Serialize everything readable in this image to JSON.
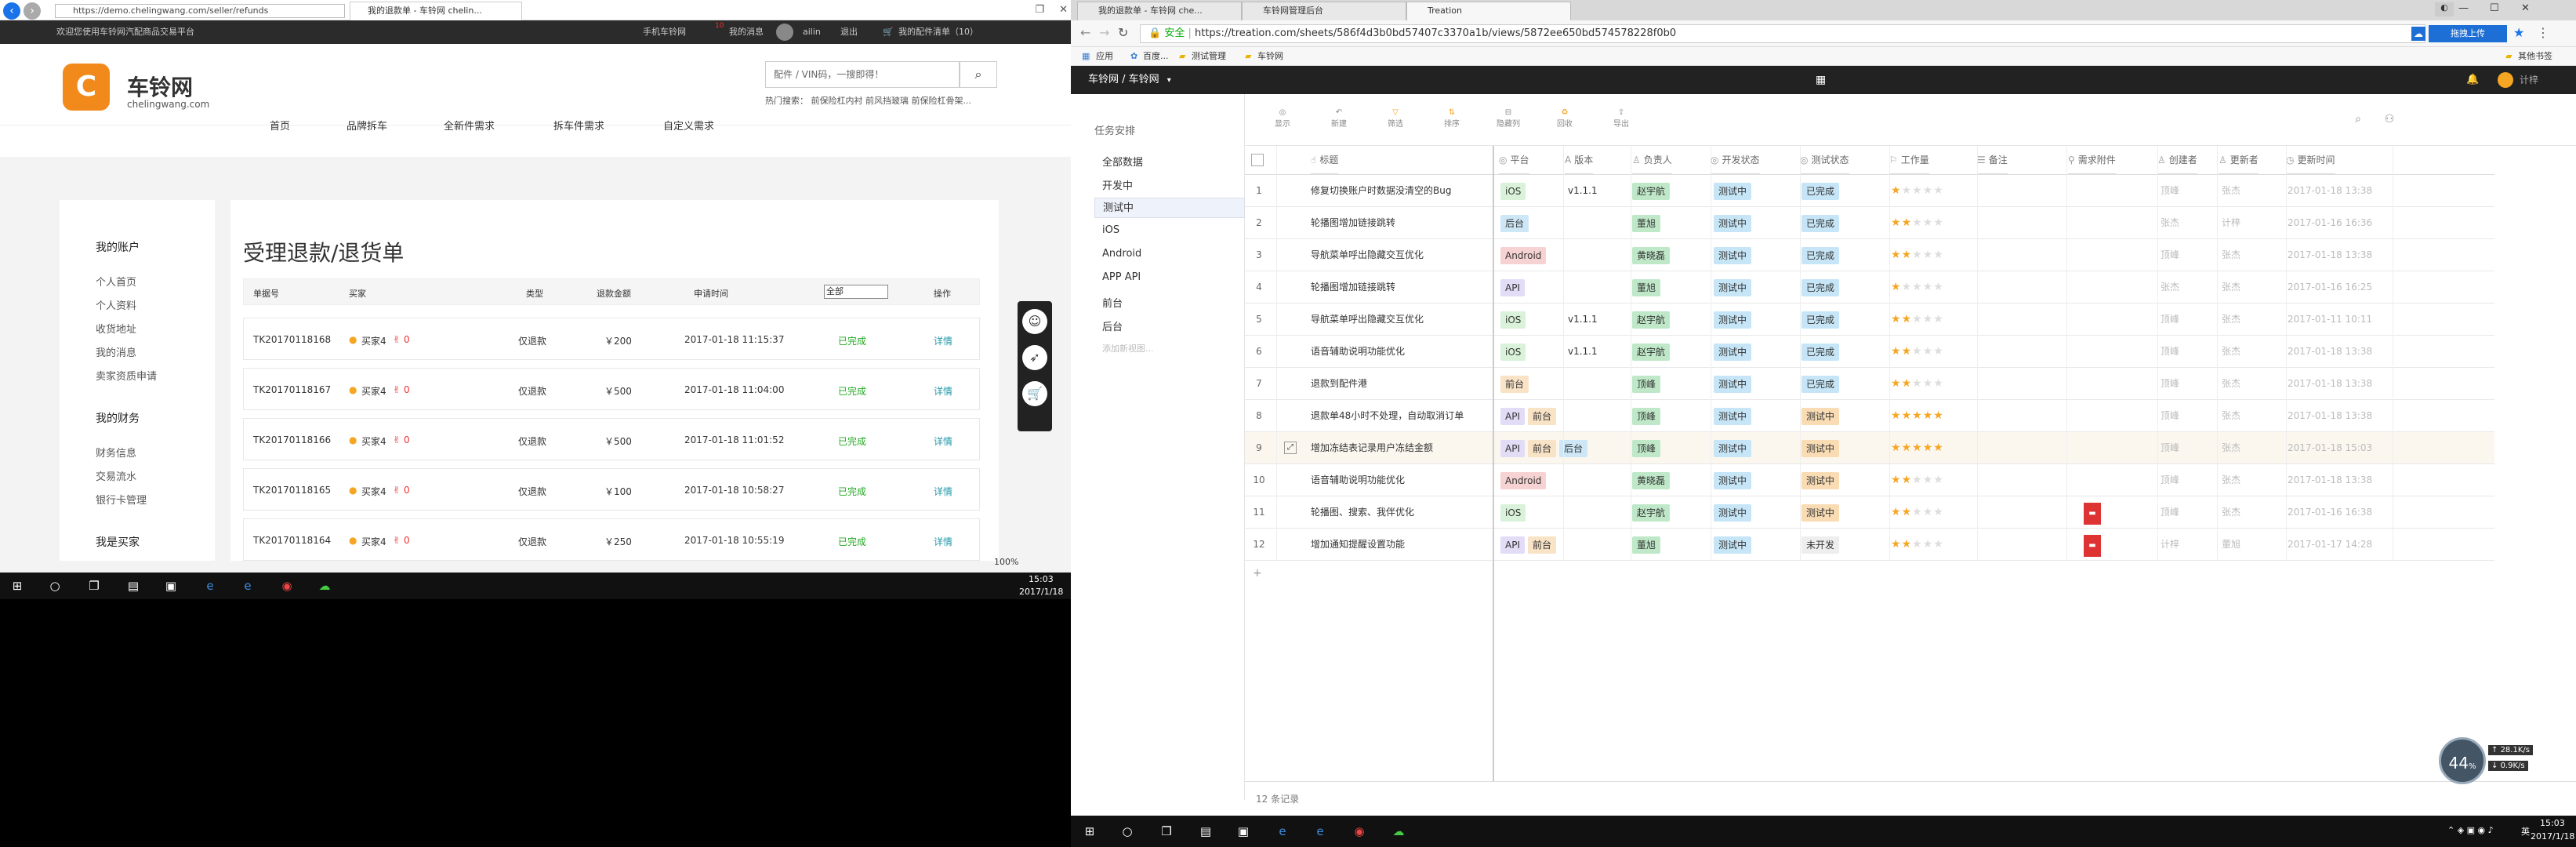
{
  "ie": {
    "url": "https://demo.chelingwang.com/seller/refunds",
    "tab": "我的退款单 - 车铃网 chelin...",
    "welcome": "欢迎您使用车铃网汽配商品交易平台",
    "top_links": [
      "手机车铃网",
      "我的消息",
      "ailin",
      "退出",
      "我的配件清单（10）"
    ],
    "msg_count": "10",
    "logo_cn": "车铃网",
    "logo_en": "chelingwang.com",
    "nav": [
      "首页",
      "品牌拆车",
      "全新件需求",
      "拆车件需求",
      "自定义需求"
    ],
    "search_placeholder": "配件 / VIN码，一搜即得！",
    "hot_search": "热门搜索：  前保险杠内衬  前风挡玻璃  前保险杠骨架...",
    "side": {
      "h1": "我的账户",
      "items1": [
        "个人首页",
        "个人资料",
        "收货地址",
        "我的消息",
        "卖家资质申请"
      ],
      "h2": "我的财务",
      "items2": [
        "财务信息",
        "交易流水",
        "银行卡管理"
      ],
      "h3": "我是买家"
    },
    "page_title": "受理退款/退货单",
    "cols": [
      "单据号",
      "买家",
      "类型",
      "退款金额",
      "申请时间",
      "全部",
      "操作"
    ],
    "rows": [
      {
        "id": "TK20170118168",
        "buyer": "买家4",
        "n": "0",
        "type": "仅退款",
        "amt": "￥200",
        "time": "2017-01-18 11:15:37",
        "status": "已完成",
        "op": "详情"
      },
      {
        "id": "TK20170118167",
        "buyer": "买家4",
        "n": "0",
        "type": "仅退款",
        "amt": "￥500",
        "time": "2017-01-18 11:04:00",
        "status": "已完成",
        "op": "详情"
      },
      {
        "id": "TK20170118166",
        "buyer": "买家4",
        "n": "0",
        "type": "仅退款",
        "amt": "￥500",
        "time": "2017-01-18 11:01:52",
        "status": "已完成",
        "op": "详情"
      },
      {
        "id": "TK20170118165",
        "buyer": "买家4",
        "n": "0",
        "type": "仅退款",
        "amt": "￥100",
        "time": "2017-01-18 10:58:27",
        "status": "已完成",
        "op": "详情"
      },
      {
        "id": "TK20170118164",
        "buyer": "买家4",
        "n": "0",
        "type": "仅退款",
        "amt": "￥250",
        "time": "2017-01-18 10:55:19",
        "status": "已完成",
        "op": "详情"
      }
    ],
    "zoom": "100%"
  },
  "taskbar_left": {
    "time": "15:03",
    "date": "2017/1/18"
  },
  "taskbar_right": {
    "time": "15:03",
    "date": "2017/1/18",
    "lang": "英"
  },
  "chrome": {
    "tabs": [
      "我的退款单 - 车铃网 che...",
      "车铃网管理后台",
      "Treation"
    ],
    "secure": "安全",
    "url": "https://treation.com/sheets/586f4d3b0bd57407c3370a1b/views/5872ee650bd574578228f0b0",
    "upload": "拖拽上传",
    "bookmarks": [
      "应用",
      "百度...",
      "测试管理",
      "车铃网"
    ],
    "other_bookmarks": "其他书签",
    "breadcrumb": "车铃网 / 车铃网",
    "user": "计梓",
    "panel_title": "任务安排",
    "views": [
      "全部数据",
      "开发中",
      "测试中",
      "iOS",
      "Android",
      "APP API",
      "前台",
      "后台",
      "添加新视图..."
    ],
    "toolbar": [
      "显示",
      "新建",
      "筛选",
      "排序",
      "隐藏列",
      "回收",
      "导出"
    ],
    "toolbar_badges": [
      "",
      "",
      "1",
      "1",
      "",
      "2",
      ""
    ],
    "headers": [
      "标题",
      "平台",
      "版本",
      "负责人",
      "开发状态",
      "测试状态",
      "工作量",
      "备注",
      "需求附件",
      "创建者",
      "更新者",
      "更新时间"
    ],
    "rows": [
      {
        "n": "1",
        "title": "修复切换账户时数据没清空的Bug",
        "platform": [
          "iOS"
        ],
        "ver": "v1.1.1",
        "owner": "赵宇航",
        "dev": "测试中",
        "test": "已完成",
        "stars": 1,
        "attach": false,
        "creator": "顶峰",
        "updater": "张杰",
        "time": "2017-01-18 13:38"
      },
      {
        "n": "2",
        "title": "轮播图增加链接跳转",
        "platform": [
          "后台"
        ],
        "ver": "",
        "owner": "董旭",
        "dev": "测试中",
        "test": "已完成",
        "stars": 2,
        "attach": false,
        "creator": "张杰",
        "updater": "计梓",
        "time": "2017-01-16 16:36"
      },
      {
        "n": "3",
        "title": "导航菜单呼出隐藏交互优化",
        "platform": [
          "Android"
        ],
        "ver": "",
        "owner": "黄晓磊",
        "dev": "测试中",
        "test": "已完成",
        "stars": 2,
        "attach": false,
        "creator": "顶峰",
        "updater": "张杰",
        "time": "2017-01-18 13:38"
      },
      {
        "n": "4",
        "title": "轮播图增加链接跳转",
        "platform": [
          "API"
        ],
        "ver": "",
        "owner": "董旭",
        "dev": "测试中",
        "test": "已完成",
        "stars": 1,
        "attach": false,
        "creator": "张杰",
        "updater": "张杰",
        "time": "2017-01-16 16:25"
      },
      {
        "n": "5",
        "title": "导航菜单呼出隐藏交互优化",
        "platform": [
          "iOS"
        ],
        "ver": "v1.1.1",
        "owner": "赵宇航",
        "dev": "测试中",
        "test": "已完成",
        "stars": 2,
        "attach": false,
        "creator": "顶峰",
        "updater": "张杰",
        "time": "2017-01-11 10:11"
      },
      {
        "n": "6",
        "title": "语音辅助说明功能优化",
        "platform": [
          "iOS"
        ],
        "ver": "v1.1.1",
        "owner": "赵宇航",
        "dev": "测试中",
        "test": "已完成",
        "stars": 2,
        "attach": false,
        "creator": "顶峰",
        "updater": "张杰",
        "time": "2017-01-18 13:38"
      },
      {
        "n": "7",
        "title": "退款到配件港",
        "platform": [
          "前台"
        ],
        "ver": "",
        "owner": "顶峰",
        "dev": "测试中",
        "test": "已完成",
        "stars": 2,
        "attach": false,
        "creator": "顶峰",
        "updater": "张杰",
        "time": "2017-01-18 13:38"
      },
      {
        "n": "8",
        "title": "退款单48小时不处理，自动取消订单",
        "platform": [
          "API",
          "前台"
        ],
        "ver": "",
        "owner": "顶峰",
        "dev": "测试中",
        "test": "测试中",
        "stars": 5,
        "attach": false,
        "creator": "顶峰",
        "updater": "张杰",
        "time": "2017-01-18 13:38"
      },
      {
        "n": "9",
        "title": "增加冻结表记录用户冻结金额",
        "platform": [
          "API",
          "前台",
          "后台"
        ],
        "ver": "",
        "owner": "顶峰",
        "dev": "测试中",
        "test": "测试中",
        "stars": 5,
        "attach": false,
        "creator": "顶峰",
        "updater": "张杰",
        "time": "2017-01-18 15:03"
      },
      {
        "n": "10",
        "title": "语音辅助说明功能优化",
        "platform": [
          "Android"
        ],
        "ver": "",
        "owner": "黄晓磊",
        "dev": "测试中",
        "test": "测试中",
        "stars": 2,
        "attach": false,
        "creator": "顶峰",
        "updater": "张杰",
        "time": "2017-01-18 13:38"
      },
      {
        "n": "11",
        "title": "轮播图、搜索、我伴优化",
        "platform": [
          "iOS"
        ],
        "ver": "",
        "owner": "赵宇航",
        "dev": "测试中",
        "test": "测试中",
        "stars": 2,
        "attach": true,
        "creator": "顶峰",
        "updater": "张杰",
        "time": "2017-01-16 16:38"
      },
      {
        "n": "12",
        "title": "增加通知提醒设置功能",
        "platform": [
          "API",
          "前台"
        ],
        "ver": "",
        "owner": "董旭",
        "dev": "测试中",
        "test": "未开发",
        "stars": 2,
        "attach": true,
        "creator": "计梓",
        "updater": "董旭",
        "time": "2017-01-17 14:28"
      }
    ],
    "add_row": "+",
    "record_count": "12 条记录",
    "net_badge": "44",
    "net_badge_unit": "%",
    "net_up": "28.1",
    "net_up_unit": "K/s",
    "net_down": "0.9",
    "net_down_unit": "K/s",
    "colors": {
      "iOS": "#d9f2d9",
      "后台": "#cde7f7",
      "Android": "#f7d2d2",
      "API": "#e3dcf7",
      "前台": "#f9e3c7",
      "owner_赵宇航": "#bfe8c8",
      "owner_董旭": "#bfe8c8",
      "owner_黄晓磊": "#bfe8c8",
      "owner_顶峰": "#bfe8c8",
      "测试中": "#c6e6f7",
      "已完成": "#c6e6f7",
      "未开发": "#eeeeee",
      "test_测试中": "#f9dcb4"
    }
  }
}
